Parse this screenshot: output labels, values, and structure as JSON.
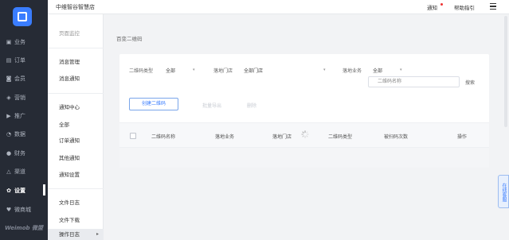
{
  "app": {
    "store_name": "中维智谷智慧店",
    "brand": "Weimob 微盟"
  },
  "topbar": {
    "notify": "通知",
    "help": "帮助指引"
  },
  "sidebar": {
    "items": [
      {
        "label": "业务",
        "icon": "briefcase-icon"
      },
      {
        "label": "订单",
        "icon": "order-icon"
      },
      {
        "label": "会员",
        "icon": "member-icon"
      },
      {
        "label": "营销",
        "icon": "marketing-icon"
      },
      {
        "label": "推广",
        "icon": "promote-icon"
      },
      {
        "label": "数据",
        "icon": "chart-icon"
      },
      {
        "label": "财务",
        "icon": "finance-icon"
      },
      {
        "label": "渠道",
        "icon": "channel-icon"
      },
      {
        "label": "设置",
        "icon": "gear-icon"
      },
      {
        "label": "微商城",
        "icon": "store-icon"
      }
    ]
  },
  "submenu": {
    "top_item": "页面监控",
    "msg_manage": "消息管理",
    "msg_notify": "消息通知",
    "notify_center": "通知中心",
    "all": "全部",
    "order_notify": "订单通知",
    "other_notify": "其他通知",
    "notify_settings": "通知设置",
    "file_log": "文件日志",
    "file_download": "文件下载",
    "op_log": "操作日志"
  },
  "main": {
    "breadcrumb": "百变二维码",
    "filters": {
      "qr_type_label": "二维码类型",
      "qr_type_value": "全部",
      "store_label": "落地门店",
      "store_value": "全部门店",
      "biz_label": "落地业务",
      "biz_value": "全部",
      "search_placeholder": "二维码名称",
      "search_button": "搜索"
    },
    "create_button": "创建二维码",
    "ghost_1": "批量导出",
    "ghost_2": "删除",
    "table": {
      "columns": [
        "二维码名称",
        "落地业务",
        "落地门店",
        "二维码类型",
        "被扫码次数",
        "操作"
      ]
    }
  },
  "consult": {
    "label": "在线客服"
  }
}
